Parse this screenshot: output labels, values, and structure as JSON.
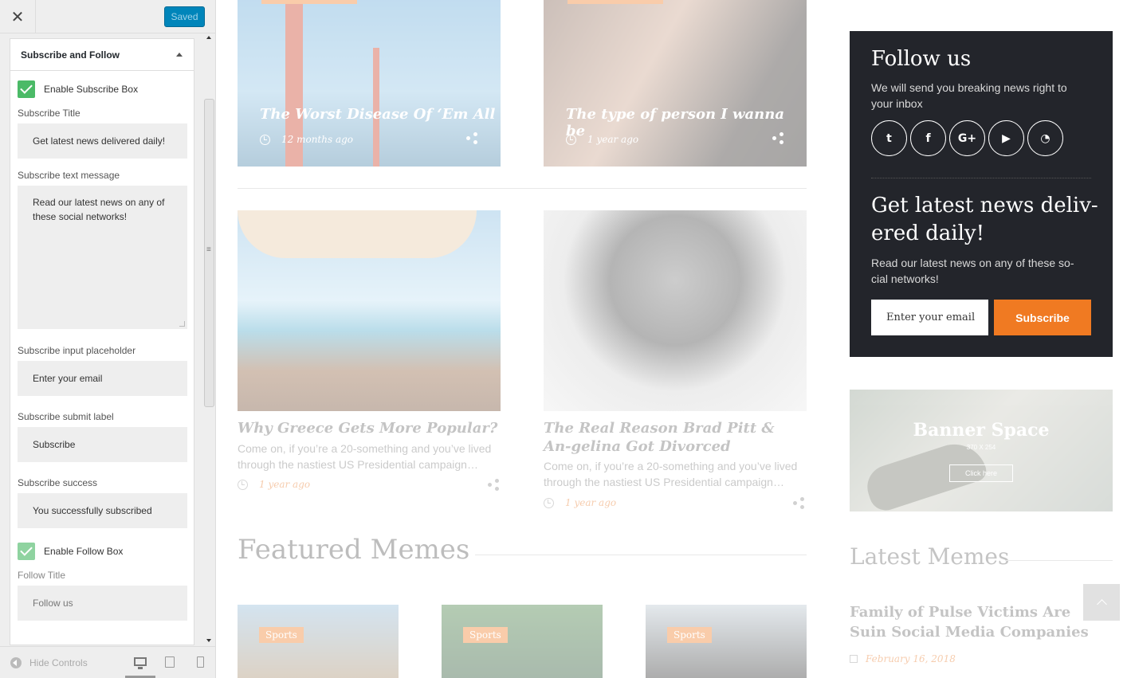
{
  "customizer": {
    "close_icon": "✕",
    "saved_label": "Saved",
    "section_title": "Subscribe and Follow",
    "enable_subscribe_label": "Enable Subscribe Box",
    "subscribe_title_label": "Subscribe Title",
    "subscribe_title_value": "Get latest news delivered daily!",
    "subscribe_text_label": "Subscribe text message",
    "subscribe_text_value": "Read our latest news on any of these social networks!",
    "subscribe_placeholder_label": "Subscribe input placeholder",
    "subscribe_placeholder_value": "Enter your email",
    "subscribe_submit_label": "Subscribe submit label",
    "subscribe_submit_value": "Subscribe",
    "subscribe_success_label": "Subscribe success",
    "subscribe_success_value": "You successfully subscribed",
    "enable_follow_label": "Enable Follow Box",
    "follow_title_label": "Follow Title",
    "follow_title_value": "Follow us",
    "hide_controls_label": "Hide Controls"
  },
  "preview": {
    "card1": {
      "title": "The Worst Disease Of ‘Em All",
      "time": "12 months ago"
    },
    "card2": {
      "title": "The type of person I wanna be",
      "time": "1 year ago"
    },
    "post1": {
      "title": "Why Greece Gets More Popular?",
      "excerpt": "Come on, if you’re a 20-something and you’ve lived through the nastiest US Presidential campaign…",
      "time": "1 year ago"
    },
    "post2": {
      "title": "The Real Reason Brad Pitt & An-gelina Got Divorced",
      "excerpt": "Come on, if you’re a 20-something and you’ve lived through the nastiest US Presidential campaign…",
      "time": "1 year ago"
    },
    "featured_title": "Featured Memes",
    "badges": [
      "Sports",
      "Sports",
      "Sports"
    ],
    "latest_title": "Latest Memes",
    "latest_post": "Family of Pulse Victims Are Suin Social Media Companies",
    "latest_date": "February 16, 2018"
  },
  "follow": {
    "title": "Follow us",
    "subtitle": "We will send you breaking news right to your inbox",
    "socials": [
      {
        "icon": "twitter-icon",
        "glyph": "t"
      },
      {
        "icon": "facebook-icon",
        "glyph": "f"
      },
      {
        "icon": "google-plus-icon",
        "glyph": "G+"
      },
      {
        "icon": "youtube-icon",
        "glyph": "▶"
      },
      {
        "icon": "rss-icon",
        "glyph": "◔"
      }
    ],
    "subscribe_title": "Get latest news deliv-ered daily!",
    "subscribe_text": "Read our latest news on any of these so-cial networks!",
    "email_placeholder": "Enter your email",
    "subscribe_button": "Subscribe"
  },
  "banner": {
    "title": "Banner Space",
    "size": "370 X 254",
    "button": "Click here"
  },
  "colors": {
    "accent": "#f07a22",
    "widget_bg": "#23252b",
    "wp_blue": "#0085ba",
    "check_green": "#4bba67"
  }
}
